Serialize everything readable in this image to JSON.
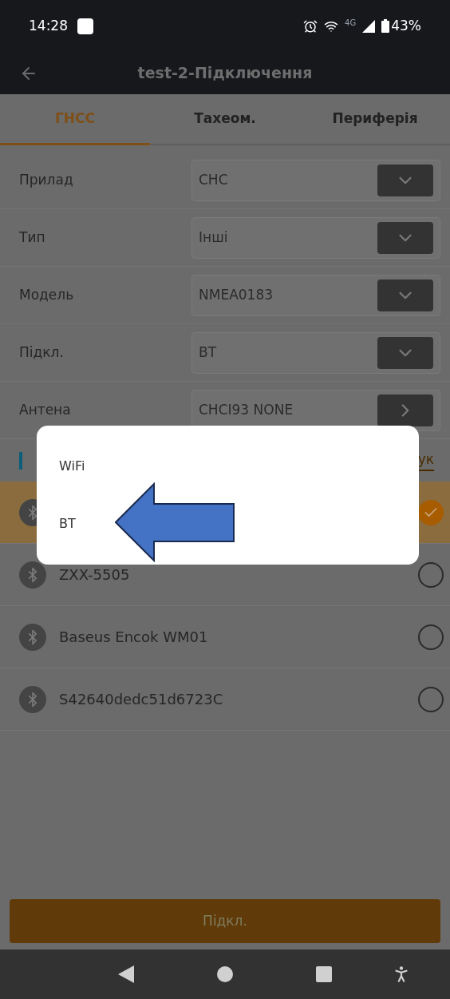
{
  "status_bar": {
    "time": "14:28",
    "network": "4G",
    "battery": "43%"
  },
  "app_bar": {
    "title": "test-2-Підключення"
  },
  "tabs": [
    {
      "label": "ГНСС",
      "selected": true
    },
    {
      "label": "Тахеом.",
      "selected": false
    },
    {
      "label": "Периферія",
      "selected": false
    }
  ],
  "form": [
    {
      "label": "Прилад",
      "value": "CHC",
      "kind": "dropdown"
    },
    {
      "label": "Тип",
      "value": "Інші",
      "kind": "dropdown"
    },
    {
      "label": "Модель",
      "value": "NMEA0183",
      "kind": "dropdown"
    },
    {
      "label": "Підкл.",
      "value": "BT",
      "kind": "dropdown"
    },
    {
      "label": "Антена",
      "value": "CHCI93 NONE",
      "kind": "link"
    }
  ],
  "section": {
    "link": "ук"
  },
  "devices": [
    {
      "selected": true
    },
    {
      "name": "ZXX-5505",
      "selected": false
    },
    {
      "name": "Baseus Encok WM01",
      "selected": false
    },
    {
      "name": "S42640dedc51d6723C",
      "selected": false
    }
  ],
  "dialog": {
    "options": [
      "WiFi",
      "BT"
    ]
  },
  "connect_button": "Підкл."
}
